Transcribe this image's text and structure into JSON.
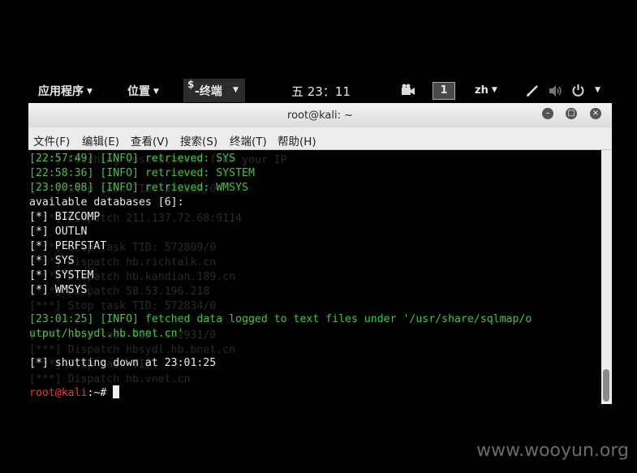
{
  "topbar": {
    "applications": "应用程序",
    "places": "位置",
    "terminal_glyph": "$",
    "terminal": "终端",
    "clock": "五 23：11",
    "workspace": "1",
    "input_method": "zh"
  },
  "window": {
    "title": "root@kali: ~",
    "menus": [
      "文件(F)",
      "编辑(E)",
      "查看(V)",
      "搜索(S)",
      "终端(T)",
      "帮助(H)"
    ]
  },
  "terminal": {
    "ghost_lines": [
      "[***] Fetching instructions from your IP",
      "[***] Stop task TID: 572807/0",
      "[***] Dispatch 211.137.72.68:9114",
      "[***] Stop task TID: 572809/0",
      "[***] Dispatch hb.richtalk.cn",
      "[***] Dispatch hb.kandian.189.cn",
      "[***] Dispatch 58.53.196.218",
      "[***] Stop task TID: 572834/0",
      "[***] Stop task TID: 572931/0",
      "[***] Dispatch hbsydl.hb.bnet.cn",
      "[***] Stop task TID:",
      "[***] Dispatch hb.vnet.cn"
    ],
    "log_lines": [
      "[22:57:49] [INFO] retrieved: SYS",
      "[22:58:36] [INFO] retrieved: SYSTEM",
      "[23:00:08] [INFO] retrieved: WMSYS"
    ],
    "db_header": "available databases [6]:",
    "databases": [
      "[*] BIZCOMP",
      "[*] OUTLN",
      "[*] PERFSTAT",
      "[*] SYS",
      "[*] SYSTEM",
      "[*] WMSYS"
    ],
    "fetched_line_1": "[23:01:25] [INFO] fetched data logged to text files under '/usr/share/sqlmap/o",
    "fetched_line_2": "utput/hbsydl.hb.bnet.cn'",
    "shutdown": "[*] shutting down at 23:01:25",
    "prompt_user": "root@kali",
    "prompt_path": ":~# "
  },
  "watermark": "www.wooyun.org"
}
